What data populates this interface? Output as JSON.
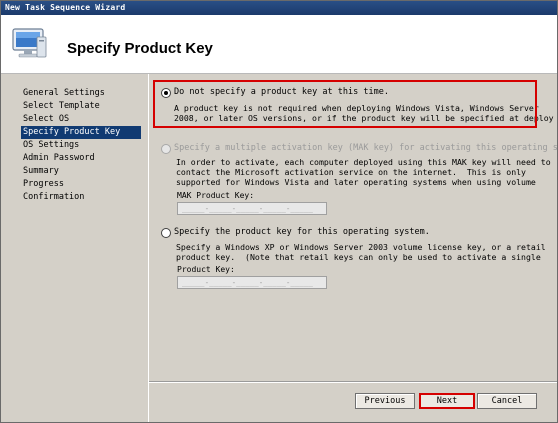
{
  "window": {
    "title": "New Task Sequence Wizard"
  },
  "header": {
    "title": "Specify Product Key",
    "icon": "computer-icon"
  },
  "nav": {
    "items": [
      {
        "label": "General Settings",
        "active": false
      },
      {
        "label": "Select Template",
        "active": false
      },
      {
        "label": "Select OS",
        "active": false
      },
      {
        "label": "Specify Product Key",
        "active": true
      },
      {
        "label": "OS Settings",
        "active": false
      },
      {
        "label": "Admin Password",
        "active": false
      },
      {
        "label": "Summary",
        "active": false
      },
      {
        "label": "Progress",
        "active": false
      },
      {
        "label": "Confirmation",
        "active": false
      }
    ]
  },
  "options": {
    "none": {
      "label": "Do not specify a product key at this time.",
      "desc": "A product key is not required when deploying Windows Vista, Windows Server\n2008, or later OS versions, or if the product key will be specified at deploy",
      "selected": true
    },
    "mak": {
      "label": "Specify a multiple activation key (MAK key) for activating this operating system",
      "desc": "In order to activate, each computer deployed using this MAK key will need to\ncontact the Microsoft activation service on the internet.  This is only\nsupported for Windows Vista and later operating systems when using volume",
      "field_label": "MAK Product Key:",
      "field_value": "_____-_____-_____-_____-_____",
      "enabled": false
    },
    "product": {
      "label": "Specify the product key for this operating system.",
      "desc": "Specify a Windows XP or Windows Server 2003 volume license key, or a retail\nproduct key.  (Note that retail keys can only be used to activate a single",
      "field_label": "Product Key:",
      "field_value": "_____-_____-_____-_____-_____",
      "selected": false
    }
  },
  "buttons": {
    "previous": "Previous",
    "next": "Next",
    "cancel": "Cancel"
  },
  "colors": {
    "highlight": "#d50000",
    "nav_active": "#103a72",
    "panel": "#d4d0c8"
  }
}
